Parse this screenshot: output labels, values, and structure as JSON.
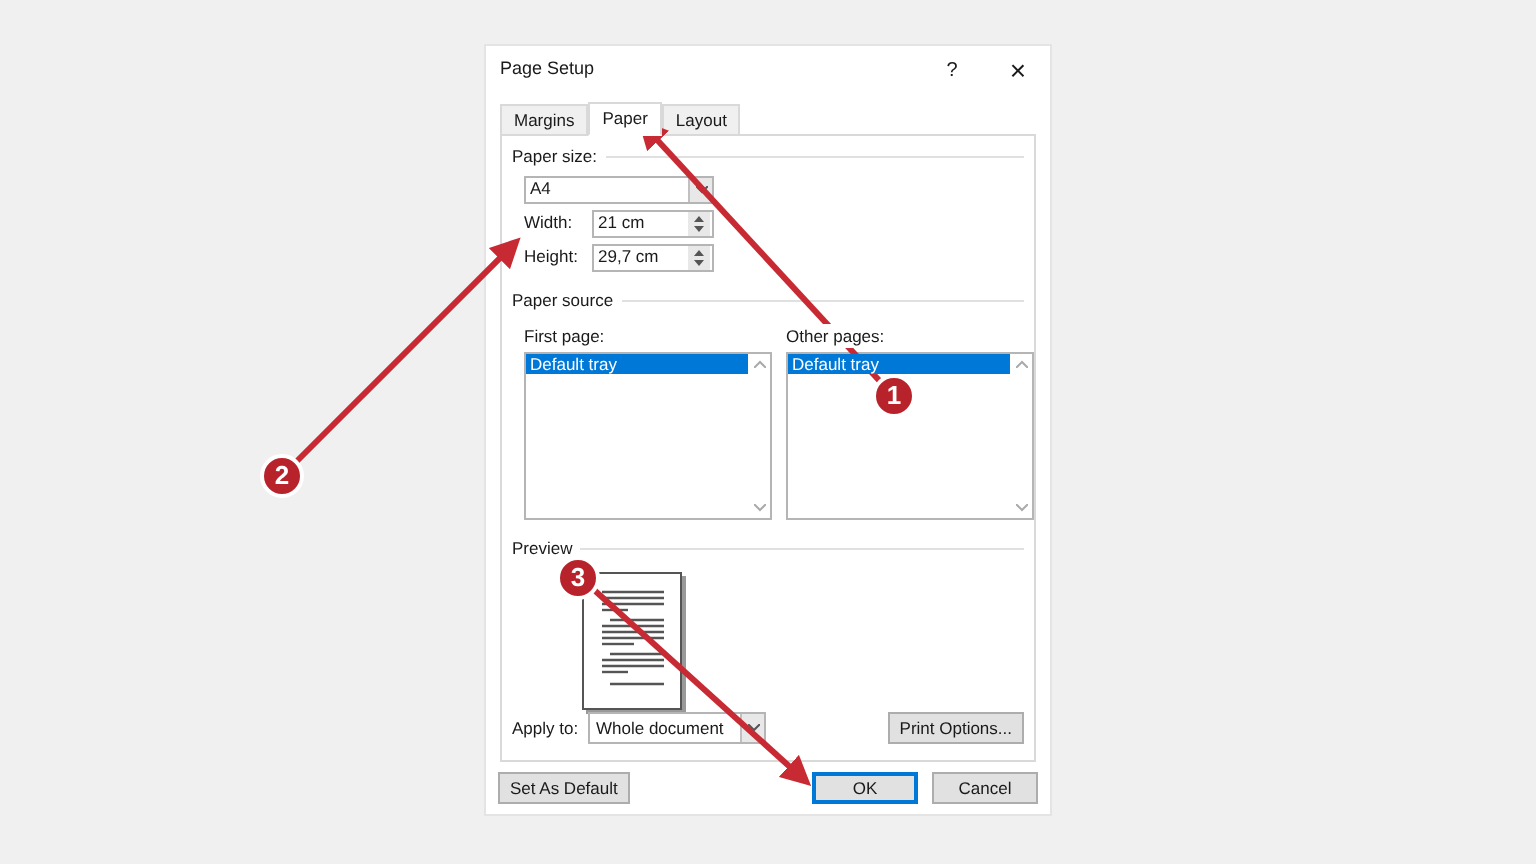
{
  "window": {
    "title": "Page Setup",
    "help": "?",
    "close": "×"
  },
  "tabs": [
    {
      "label": "Margins",
      "selected": false
    },
    {
      "label": "Paper",
      "selected": true
    },
    {
      "label": "Layout",
      "selected": false
    }
  ],
  "paper_size": {
    "label": "Paper size:",
    "value": "A4",
    "width_label": "Width:",
    "width": "21 cm",
    "height_label": "Height:",
    "height": "29,7 cm"
  },
  "paper_source": {
    "label": "Paper source",
    "lists": [
      {
        "label": "First page:",
        "items": [
          {
            "label": "Default tray",
            "selected": true
          }
        ]
      },
      {
        "label": "Other pages:",
        "items": [
          {
            "label": "Default tray",
            "selected": true
          }
        ]
      }
    ]
  },
  "preview": {
    "label": "Preview",
    "apply_to_label": "Apply to:",
    "apply_to": "Whole document",
    "print_options": "Print Options..."
  },
  "footer": {
    "set_default": "Set As Default",
    "buttons": [
      {
        "label": "OK",
        "default": true
      },
      {
        "label": "Cancel",
        "default": false
      }
    ]
  },
  "annotations": [
    {
      "number": "1"
    },
    {
      "number": "2"
    },
    {
      "number": "3"
    }
  ]
}
